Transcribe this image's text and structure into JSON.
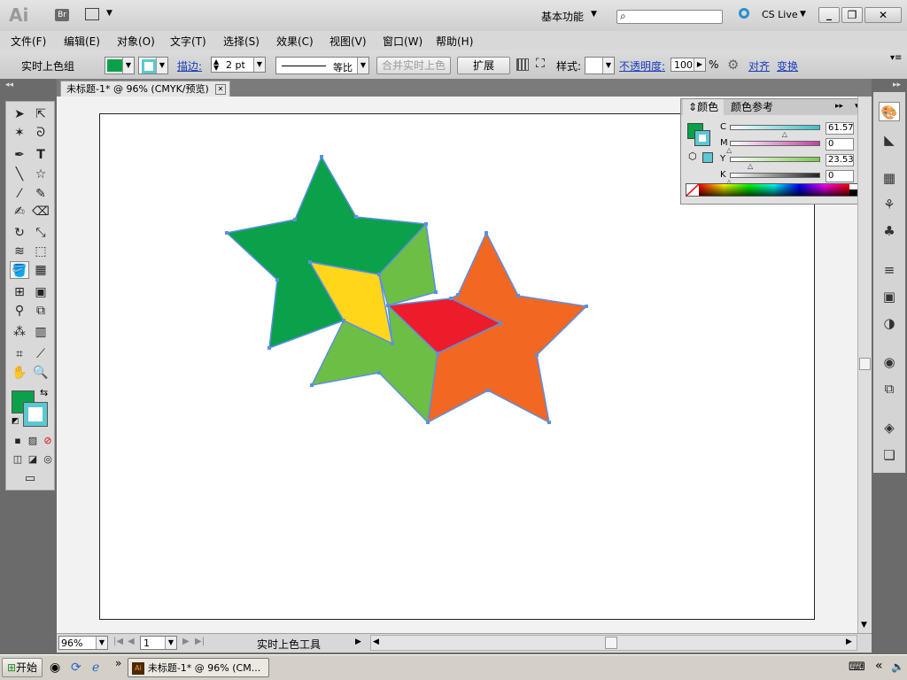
{
  "app": {
    "logo": "Ai",
    "bridge": "Br",
    "workspace": "基本功能",
    "search_placeholder": "",
    "cslive": "CS Live",
    "window_buttons": [
      "minimize-icon",
      "restore-icon",
      "close-icon"
    ]
  },
  "menu": [
    "文件(F)",
    "编辑(E)",
    "对象(O)",
    "文字(T)",
    "选择(S)",
    "效果(C)",
    "视图(V)",
    "窗口(W)",
    "帮助(H)"
  ],
  "control": {
    "selection_label": "实时上色组",
    "fill_color": "#0ba14b",
    "stroke_color": "#5bc8d2",
    "stroke_label": "描边:",
    "stroke_weight": "2 pt",
    "stroke_profile": "等比",
    "merge_button": "合并实时上色",
    "expand_button": "扩展",
    "style_label": "样式:",
    "opacity_label": "不透明度:",
    "opacity_value": "100",
    "opacity_unit": "%",
    "align_link": "对齐",
    "transform_link": "变换"
  },
  "document": {
    "tab_title": "未标题-1* @ 96% (CMYK/预览)"
  },
  "color_panel": {
    "tabs": [
      "颜色",
      "颜色参考"
    ],
    "channels": [
      {
        "name": "C",
        "value": "61.57",
        "unit": "%",
        "color": "#3bbec8",
        "level": 0.6157
      },
      {
        "name": "M",
        "value": "0",
        "unit": "%",
        "color": "#c040a0",
        "level": 0
      },
      {
        "name": "Y",
        "value": "23.53",
        "unit": "%",
        "color": "#7dc850",
        "level": 0.2353
      },
      {
        "name": "K",
        "value": "0",
        "unit": "%",
        "color": "#222222",
        "level": 0
      }
    ],
    "fill_color": "#0ba14b",
    "stroke_color": "#5bc8d2"
  },
  "artwork": {
    "colors": {
      "dark_green": "#0ba14b",
      "light_green": "#6dbe45",
      "orange": "#f26722",
      "yellow": "#ffd61a",
      "red": "#ec1c2b",
      "stroke": "#5b8fe6"
    }
  },
  "status": {
    "zoom": "96%",
    "page": "1",
    "tool_name": "实时上色工具"
  },
  "taskbar": {
    "start": "开始",
    "task": "未标题-1* @ 96% (CM..."
  }
}
